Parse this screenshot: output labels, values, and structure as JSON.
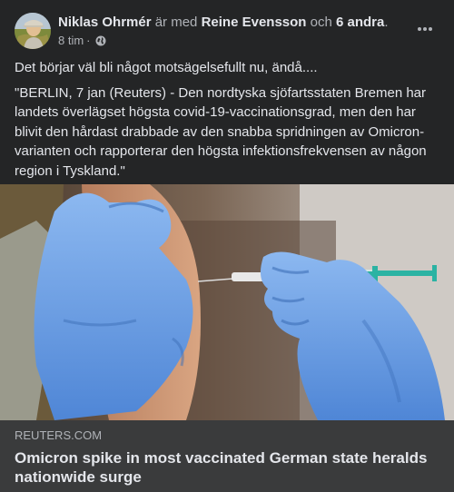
{
  "post": {
    "author": "Niklas Ohrmér",
    "with_text": "är med",
    "tagged_person": "Reine Evensson",
    "and_text": "och",
    "others": "6 andra",
    "period": ".",
    "time": "8 tim",
    "separator": "·",
    "privacy_icon": "globe-icon",
    "more_icon": "more-dots-icon",
    "comment": "Det börjar väl bli något motsägelsefullt nu, ändå....",
    "quote": "\"BERLIN, 7 jan (Reuters) - Den nordtyska sjöfartsstaten Bremen har landets överlägset högsta covid-19-vaccinationsgrad, men den har blivit den hårdast drabbade av den snabba spridningen av Omicron-varianten och rapporterar den högsta infektionsfrekvensen av någon region i Tyskland.\""
  },
  "link": {
    "domain": "REUTERS.COM",
    "headline": "Omicron spike in most vaccinated German state heralds nationwide surge"
  },
  "colors": {
    "card_bg": "#242526",
    "link_bg": "#3a3b3c",
    "primary_text": "#e4e6eb",
    "secondary_text": "#b0b3b8",
    "glove_blue": "#6fa3e6",
    "syringe_green": "#2bb3a3"
  }
}
